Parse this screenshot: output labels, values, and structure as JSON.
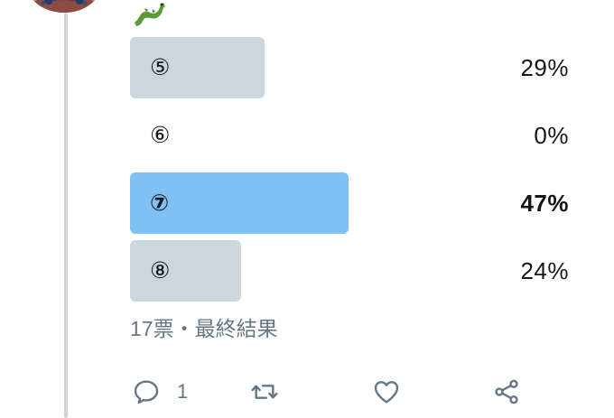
{
  "tweet": {
    "emoji_icon": "dragon-emoji-icon"
  },
  "poll": {
    "options": [
      {
        "label": "⑤",
        "percent": "29%",
        "fraction": 0.29,
        "winner": false
      },
      {
        "label": "⑥",
        "percent": "0%",
        "fraction": 0.0,
        "winner": false
      },
      {
        "label": "⑦",
        "percent": "47%",
        "fraction": 0.47,
        "winner": true
      },
      {
        "label": "⑧",
        "percent": "24%",
        "fraction": 0.24,
        "winner": false
      }
    ],
    "meta": "17票・最終結果",
    "colors": {
      "bar": "#ccd6dd",
      "winner_bar": "#7fc1f3"
    }
  },
  "actions": {
    "reply": {
      "icon": "reply-icon",
      "count": "1"
    },
    "retweet": {
      "icon": "retweet-icon"
    },
    "like": {
      "icon": "heart-icon"
    },
    "share": {
      "icon": "share-icon"
    }
  }
}
